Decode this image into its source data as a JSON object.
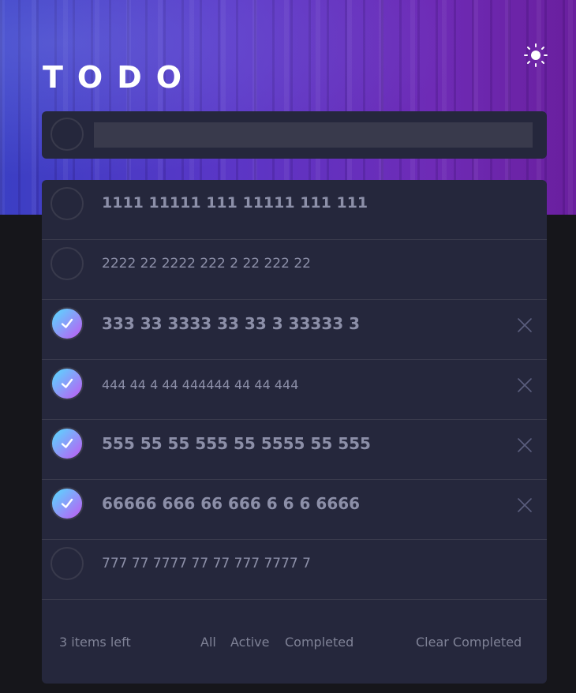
{
  "app": {
    "title": "TODO"
  },
  "new_todo": {
    "value": ""
  },
  "todos": [
    {
      "text": "1111 11111 111 11111 111 111",
      "completed": false
    },
    {
      "text": "2222 22 2222 222 2 22 222 22",
      "completed": false
    },
    {
      "text": "333 33 3333 33 33 3 33333 3",
      "completed": true
    },
    {
      "text": "444 44 4 44 444444 44 44 444",
      "completed": true
    },
    {
      "text": "555 55 55 555 55 5555 55 555",
      "completed": true
    },
    {
      "text": "66666 666 66 666 6 6 6 6666",
      "completed": true
    },
    {
      "text": "777 77 7777 77 77 777 7777 7",
      "completed": false
    }
  ],
  "footer": {
    "items_left": "3 items left",
    "filters": [
      "All",
      "Active",
      "Completed"
    ],
    "clear_completed": "Clear Completed"
  },
  "icons": {
    "theme_toggle": "sun-icon",
    "check": "checkmark-icon",
    "delete": "cross-icon"
  },
  "colors": {
    "accent_gradient_start": "#55ddff",
    "accent_gradient_end": "#c058f3",
    "card_bg": "#25273c",
    "page_bg": "#16161b",
    "text_muted": "#8c8fa8"
  }
}
